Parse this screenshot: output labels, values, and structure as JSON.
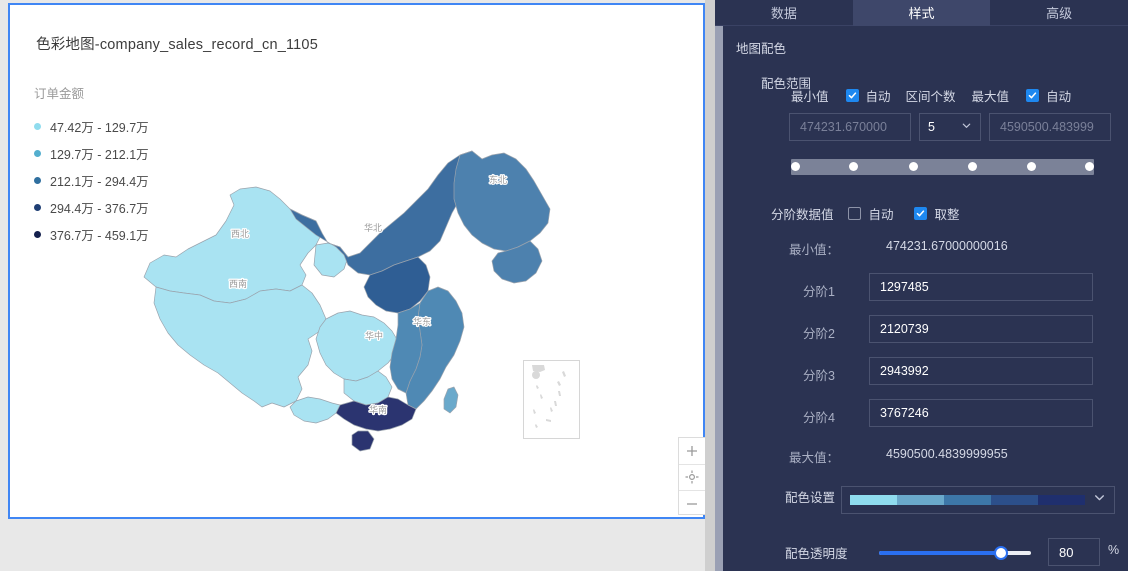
{
  "chart_card": {
    "title": "色彩地图-company_sales_record_cn_1105",
    "legend": {
      "title": "订单金额",
      "items": [
        {
          "label": "47.42万 - 129.7万",
          "color": "#90dcee"
        },
        {
          "label": "129.7万 - 212.1万",
          "color": "#53aece"
        },
        {
          "label": "212.1万 - 294.4万",
          "color": "#2f6f9f"
        },
        {
          "label": "294.4万 - 376.7万",
          "color": "#1f3f74"
        },
        {
          "label": "376.7万 - 459.1万",
          "color": "#14204d"
        }
      ]
    },
    "map": {
      "region_labels": [
        "西北",
        "西南",
        "华北",
        "东北",
        "华中",
        "华东",
        "华南"
      ],
      "controls": [
        {
          "name": "zoom-in",
          "glyph": "+"
        },
        {
          "name": "recenter",
          "glyph": "✛"
        },
        {
          "name": "zoom-out",
          "glyph": "−"
        }
      ]
    }
  },
  "panel": {
    "tabs": [
      {
        "label": "数据",
        "active": false
      },
      {
        "label": "样式",
        "active": true
      },
      {
        "label": "高级",
        "active": false
      }
    ],
    "section_title": "地图配色",
    "color_range": {
      "title": "配色范围",
      "min_label": "最小值",
      "min_auto_label": "自动",
      "min_auto_checked": true,
      "min_placeholder": "474231.670000",
      "count_label": "区间个数",
      "count_value": "5",
      "max_label": "最大值",
      "max_auto_label": "自动",
      "max_auto_checked": true,
      "max_placeholder": "4590500.483999"
    },
    "step_values": {
      "title": "分阶数据值",
      "auto_label": "自动",
      "auto_checked": false,
      "round_label": "取整",
      "round_checked": true,
      "min_label": "最小值：",
      "min_value": "474231.67000000016",
      "steps": [
        {
          "label": "分阶1",
          "value": "1297485"
        },
        {
          "label": "分阶2",
          "value": "2120739"
        },
        {
          "label": "分阶3",
          "value": "2943992"
        },
        {
          "label": "分阶4",
          "value": "3767246"
        }
      ],
      "max_label": "最大值：",
      "max_value": "4590500.4839999955"
    },
    "palette": {
      "label": "配色设置",
      "colors": [
        "#8fdcef",
        "#6aa9cb",
        "#3d77a8",
        "#2c4f8a",
        "#1f2f6e"
      ]
    },
    "opacity": {
      "label": "配色透明度",
      "value": "80",
      "unit": "%",
      "percent": 80
    }
  },
  "chart_data": {
    "type": "heatmap",
    "title": "色彩地图-company_sales_record_cn_1105",
    "ylabel": "订单金额",
    "categories": [
      "西北",
      "西南",
      "华北",
      "东北",
      "华中",
      "华东",
      "华南"
    ],
    "bins": [
      {
        "range": "47.42万 - 129.7万",
        "min": 474231.67,
        "max": 1297485,
        "color": "#90dcee"
      },
      {
        "range": "129.7万 - 212.1万",
        "min": 1297485,
        "max": 2120739,
        "color": "#53aece"
      },
      {
        "range": "212.1万 - 294.4万",
        "min": 2120739,
        "max": 2943992,
        "color": "#2f6f9f"
      },
      {
        "range": "294.4万 - 376.7万",
        "min": 2943992,
        "max": 3767246,
        "color": "#1f3f74"
      },
      {
        "range": "376.7万 - 459.1万",
        "min": 3767246,
        "max": 4590500.48,
        "color": "#14204d"
      }
    ],
    "region_bins": [
      {
        "region": "西北",
        "bin": 1
      },
      {
        "region": "西南",
        "bin": 1
      },
      {
        "region": "华中",
        "bin": 1
      },
      {
        "region": "华北",
        "bin": 4
      },
      {
        "region": "东北",
        "bin": 3
      },
      {
        "region": "华东",
        "bin": 2
      },
      {
        "region": "华南",
        "bin": 5
      }
    ],
    "legend": "left"
  }
}
